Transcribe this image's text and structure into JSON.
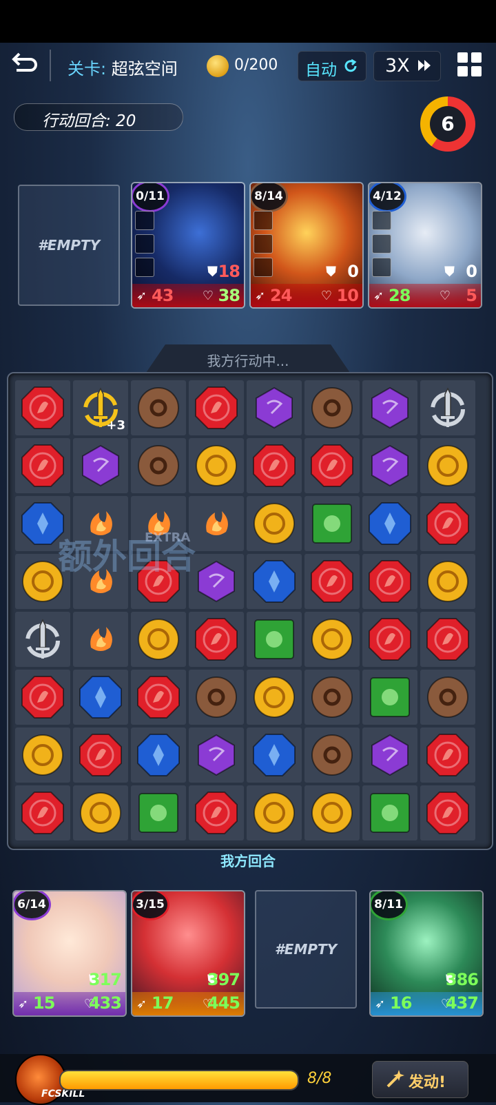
{
  "topbar": {
    "stage_label": "关卡:",
    "stage_name": "超弦空间",
    "currency": "0/200",
    "auto_label": "自动",
    "speed_label": "3X"
  },
  "turns": {
    "label": "行动回合: 20"
  },
  "counter": {
    "value": "6"
  },
  "empty_label": "#EMPTY",
  "enemies": [
    {
      "cooldown": "0/11",
      "def": "18",
      "atk": "43",
      "hp": "38"
    },
    {
      "cooldown": "8/14",
      "def": "0",
      "atk": "24",
      "hp": "10"
    },
    {
      "cooldown": "4/12",
      "def": "0",
      "atk": "28",
      "hp": "5"
    }
  ],
  "board": {
    "header": "我方行动中...",
    "footer": "我方回合",
    "extra_label": "额外回合",
    "extra_sub": "EXTRA",
    "grid": [
      [
        "red",
        "sword-gold",
        "brown",
        "red",
        "purple",
        "brown",
        "purple",
        "sword-silver"
      ],
      [
        "red",
        "purple",
        "brown",
        "gold",
        "red",
        "red",
        "purple",
        "gold"
      ],
      [
        "blue",
        "flame",
        "flame",
        "flame",
        "gold",
        "green",
        "blue",
        "red"
      ],
      [
        "gold",
        "flame",
        "red",
        "purple",
        "blue",
        "red",
        "red",
        "gold"
      ],
      [
        "sword-silver",
        "flame",
        "gold",
        "red",
        "green",
        "gold",
        "red",
        "red"
      ],
      [
        "red",
        "blue",
        "red",
        "brown",
        "gold",
        "brown",
        "green",
        "brown"
      ],
      [
        "gold",
        "red",
        "blue",
        "purple",
        "blue",
        "brown",
        "purple",
        "red"
      ],
      [
        "red",
        "gold",
        "green",
        "red",
        "gold",
        "gold",
        "green",
        "red"
      ]
    ],
    "sword_bonus": "+3"
  },
  "allies": [
    {
      "cooldown": "6/14",
      "def": "317",
      "atk": "15",
      "hp": "433"
    },
    {
      "cooldown": "3/15",
      "def": "397",
      "atk": "17",
      "hp": "445"
    },
    {
      "cooldown": "8/11",
      "def": "386",
      "atk": "16",
      "hp": "437"
    }
  ],
  "bottom": {
    "fc_label": "FCSKILL",
    "energy_text": "8/8",
    "energy_fraction": 1.0,
    "activate_label": "发动!"
  },
  "colors": {
    "red": "#e0202a",
    "gold": "#f1b21a",
    "brown": "#8a5a3c",
    "purple": "#8b3bd4",
    "blue": "#1f5ed3",
    "green": "#2fa336",
    "flame": "#ff8a2a"
  }
}
